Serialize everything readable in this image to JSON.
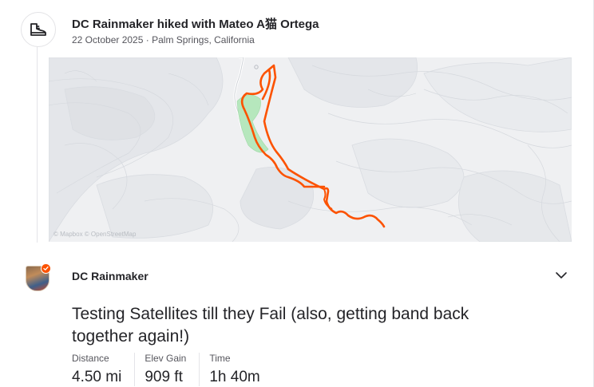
{
  "header": {
    "title": "DC Rainmaker hiked with Mateo A猫 Ortega",
    "date": "22 October 2025",
    "separator": "·",
    "location": "Palm Springs, California",
    "icon": "hiking-boot-icon"
  },
  "map": {
    "attribution": "© Mapbox © OpenStreetMap",
    "route_color": "#fc5200",
    "water_color": "#b6e7bd"
  },
  "athlete": {
    "name": "DC Rainmaker",
    "verified": true
  },
  "activity": {
    "title": "Testing Satellites till they Fail (also, getting band back together again!)",
    "stats": [
      {
        "label": "Distance",
        "value": "4.50 mi"
      },
      {
        "label": "Elev Gain",
        "value": "909 ft"
      },
      {
        "label": "Time",
        "value": "1h 40m"
      }
    ]
  },
  "colors": {
    "accent": "#fc5200",
    "text": "#242428",
    "muted": "#55555c"
  }
}
